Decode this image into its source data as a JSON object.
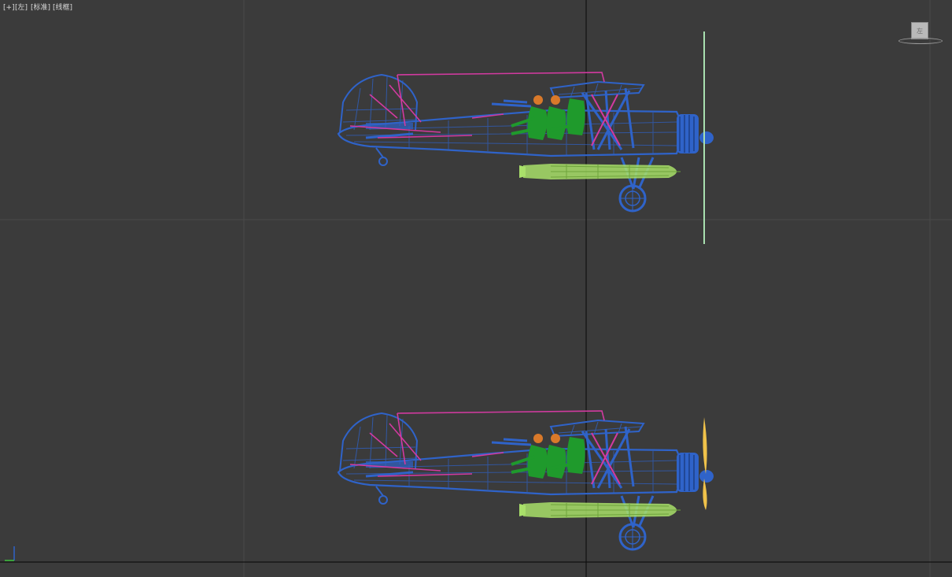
{
  "viewport": {
    "labels": [
      "[+]",
      "[左]",
      "[标准]",
      "[线框]"
    ],
    "view": "left",
    "shading": "wireframe"
  },
  "viewcube": {
    "face_label": "左"
  },
  "colors": {
    "background": "#3b3b3b",
    "grid": "#4a4a4a",
    "axis_line": "#101010",
    "airframe": "#2f63c9",
    "rigging": "#d23aa0",
    "torpedo": "#a9e06a",
    "crew": "#1f9a2c",
    "helmet": "#d9792a",
    "propeller_blur": "#a8e0b0",
    "propeller": "#f0c24a"
  },
  "models": [
    {
      "name": "biplane-upper",
      "propeller_state": "edge-on"
    },
    {
      "name": "biplane-lower",
      "propeller_state": "blades"
    }
  ],
  "icons": {
    "axis_gizmo": "axis-tripod-icon"
  }
}
